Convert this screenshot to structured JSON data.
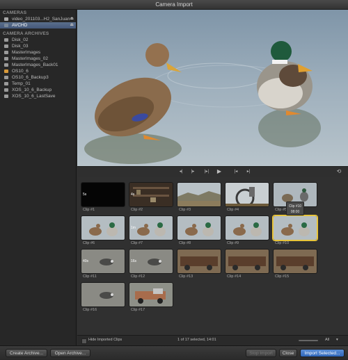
{
  "window": {
    "title": "Camera Import"
  },
  "sidebar": {
    "cameras_header": "CAMERAS",
    "cameras": [
      {
        "label": "video_201103...H2_SanJuan",
        "icon": "folder-icon",
        "eject": "⏏"
      },
      {
        "label": "AVCHD",
        "icon": "camera-icon",
        "eject": "⏏"
      }
    ],
    "archives_header": "CAMERA ARCHIVES",
    "archives": [
      {
        "label": "Disk_02",
        "icon": "disk-icon"
      },
      {
        "label": "Disk_03",
        "icon": "disk-icon"
      },
      {
        "label": "MasterImages",
        "icon": "disk-icon"
      },
      {
        "label": "MasterImages_02",
        "icon": "disk-icon"
      },
      {
        "label": "MasterImages_Back01",
        "icon": "disk-icon"
      },
      {
        "label": "OS10_6",
        "icon": "orange-disk-icon"
      },
      {
        "label": "OS10_6_Backup3",
        "icon": "disk-icon"
      },
      {
        "label": "Temp_01",
        "icon": "disk-icon"
      },
      {
        "label": "XOS_10_6_Backup",
        "icon": "disk-icon"
      },
      {
        "label": "XOS_10_6_LastSave",
        "icon": "disk-icon"
      }
    ]
  },
  "controls": {
    "buttons": [
      "◂|",
      "|▸",
      "|▸|",
      "▶",
      "|◂",
      "▸|"
    ],
    "loop": "⟲"
  },
  "clips": [
    {
      "name": "Clip #1",
      "duration": "5s",
      "scene": "black"
    },
    {
      "name": "Clip #2",
      "duration": "4s",
      "scene": "shelf"
    },
    {
      "name": "Clip #3",
      "duration": "",
      "scene": "landscape"
    },
    {
      "name": "Clip #4",
      "duration": "",
      "scene": "wheel"
    },
    {
      "name": "Clip #5",
      "duration": "",
      "scene": "birds"
    },
    {
      "name": "Clip #6",
      "duration": "",
      "scene": "ducks"
    },
    {
      "name": "Clip #7",
      "duration": "1m",
      "scene": "ducks"
    },
    {
      "name": "Clip #8",
      "duration": "",
      "scene": "ducks"
    },
    {
      "name": "Clip #9",
      "duration": "",
      "scene": "ducks"
    },
    {
      "name": "Clip #10",
      "duration": "",
      "scene": "ducks"
    },
    {
      "name": "Clip #11",
      "duration": "40s",
      "scene": "gravel"
    },
    {
      "name": "Clip #12",
      "duration": "16s",
      "scene": "gravel"
    },
    {
      "name": "Clip #13",
      "duration": "",
      "scene": "rust"
    },
    {
      "name": "Clip #14",
      "duration": "",
      "scene": "rust"
    },
    {
      "name": "Clip #15",
      "duration": "",
      "scene": "rust"
    },
    {
      "name": "Clip #16",
      "duration": "",
      "scene": "gravel"
    },
    {
      "name": "Clip #17",
      "duration": "",
      "scene": "truck"
    }
  ],
  "selected_clip": 10,
  "tooltip": {
    "name": "Clip #10",
    "time": "08:00"
  },
  "status": {
    "hide_imported_label": "Hide Imported Clips",
    "selection": "1 of 17 selected, 14:01",
    "filter": "All"
  },
  "buttons": {
    "create_archive": "Create Archive...",
    "open_archive": "Open Archive...",
    "stop_import": "Stop Import",
    "close": "Close",
    "import_selected": "Import Selected..."
  }
}
